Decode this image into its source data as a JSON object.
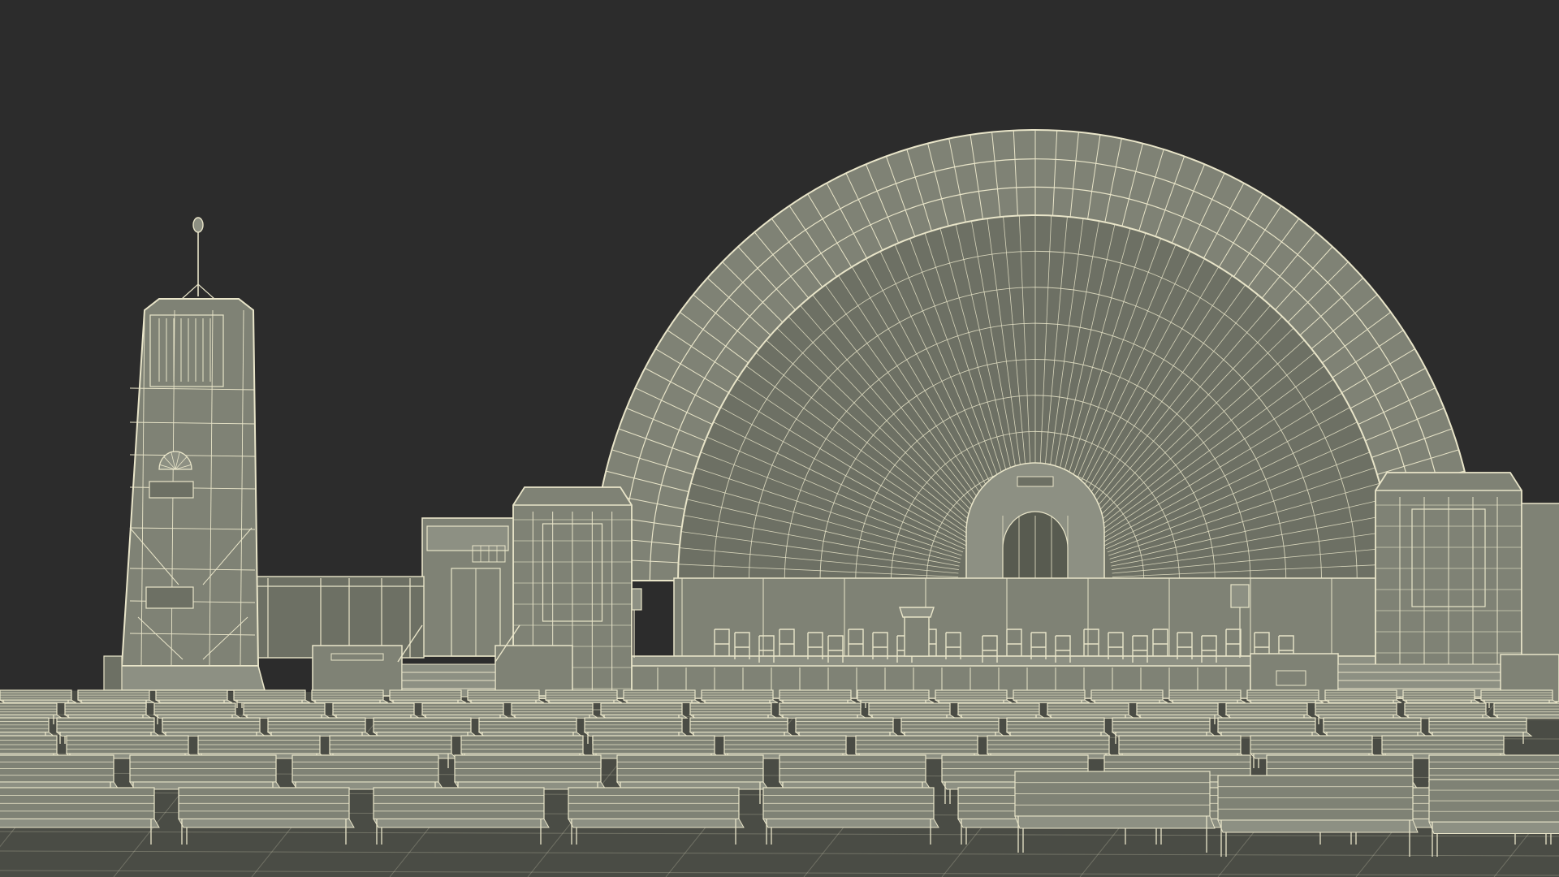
{
  "scene": {
    "subject": "wireframe-3d-render",
    "colors": {
      "background": "#2c2c2c",
      "surface": "#7f8275",
      "surface_dark": "#6d7064",
      "surface_light": "#8d9083",
      "shadow": "#585b50",
      "wire": "#e9e5c9",
      "ground": "#4a4c45"
    }
  }
}
